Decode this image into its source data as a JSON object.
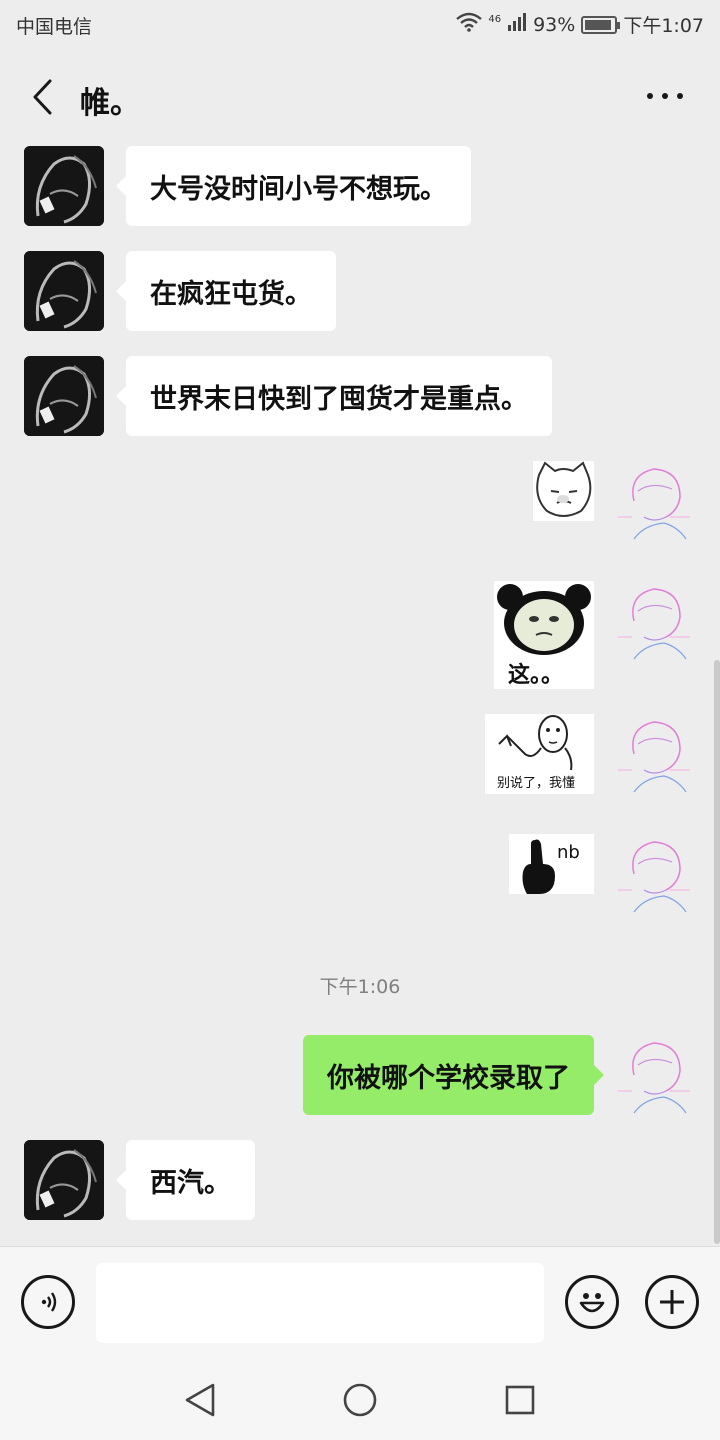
{
  "status_bar": {
    "carrier": "中国电信",
    "network": "46",
    "battery": "93%",
    "battery_level": 0.93,
    "time": "下午1:07"
  },
  "header": {
    "title": "帷。"
  },
  "messages": [
    {
      "from": "other",
      "type": "text",
      "text": "大号没时间小号不想玩。"
    },
    {
      "from": "other",
      "type": "text",
      "text": "在疯狂屯货。"
    },
    {
      "from": "other",
      "type": "text",
      "text": "世界末日快到了囤货才是重点。"
    },
    {
      "from": "self",
      "type": "sticker",
      "caption": ""
    },
    {
      "from": "self",
      "type": "sticker",
      "caption": "这。。"
    },
    {
      "from": "self",
      "type": "sticker",
      "caption": "别说了，我懂"
    },
    {
      "from": "self",
      "type": "sticker",
      "caption": "nb"
    },
    {
      "type": "timestamp",
      "text": "下午1:06"
    },
    {
      "from": "self",
      "type": "text",
      "text": "你被哪个学校录取了"
    },
    {
      "from": "other",
      "type": "text",
      "text": "西汽。"
    }
  ],
  "input_bar": {
    "value": "",
    "placeholder": ""
  },
  "colors": {
    "background": "#ededed",
    "bubble_other": "#ffffff",
    "bubble_self": "#95ec69"
  },
  "icons": [
    "back-arrow-icon",
    "more-icon",
    "voice-icon",
    "emoji-icon",
    "plus-icon",
    "nav-back-icon",
    "nav-home-icon",
    "nav-recents-icon"
  ]
}
